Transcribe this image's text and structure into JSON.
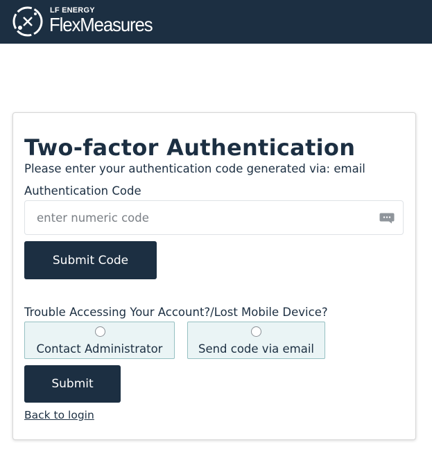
{
  "header": {
    "brand_sub": "LF ENERGY",
    "brand_name": "FlexMeasures",
    "logo_icon": "flexmeasures-logo-icon",
    "background_color": "#1c2f42"
  },
  "form": {
    "title": "Two-factor Authentication",
    "subtitle": "Please enter your authentication code generated via: email",
    "code_label": "Authentication Code",
    "code_placeholder": "enter numeric code",
    "code_value": "",
    "password_manager_icon": "keyboard-dots-icon",
    "submit_code_label": "Submit Code",
    "trouble_text": "Trouble Accessing Your Account?/Lost Mobile Device?",
    "options": [
      {
        "label": "Contact Administrator",
        "selected": false
      },
      {
        "label": "Send code via email",
        "selected": false
      }
    ],
    "submit_label": "Submit",
    "back_link": "Back to login"
  },
  "colors": {
    "primary": "#1c2f42",
    "option_bg": "#eaf4f5",
    "option_border": "#95c0c2"
  }
}
